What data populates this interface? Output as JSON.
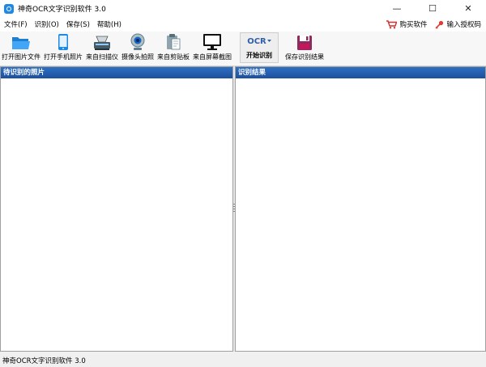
{
  "window": {
    "title": "神奇OCR文字识别软件 3.0",
    "minimize": "—",
    "maximize": "☐",
    "close": "✕"
  },
  "menu": {
    "items": [
      "文件(F)",
      "识别(O)",
      "保存(S)",
      "帮助(H)"
    ],
    "buy": "购买软件",
    "license": "输入授权码"
  },
  "toolbar": {
    "open_image": "打开图片文件",
    "open_phone": "打开手机照片",
    "scanner": "来自扫描仪",
    "camera": "摄像头拍照",
    "clipboard": "来自剪贴板",
    "screen": "来自屏幕截图",
    "ocr_word": "OCR",
    "ocr_label": "开始识别",
    "save_result": "保存识别结果"
  },
  "panels": {
    "left_title": "待识别的照片",
    "right_title": "识别结果"
  },
  "status": {
    "text": "神奇OCR文字识别软件 3.0"
  },
  "colors": {
    "panel_header": "#1d4f9c",
    "accent": "#1e88e5"
  }
}
